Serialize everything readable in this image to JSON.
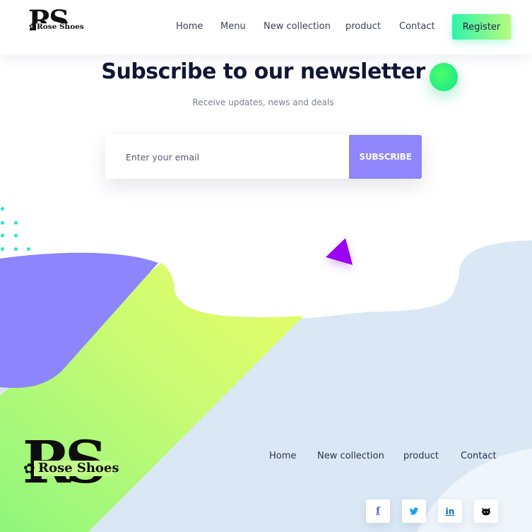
{
  "header": {
    "logo": {
      "monogram": "RS",
      "name": "Rose Shoes"
    },
    "nav": [
      "Home",
      "Menu",
      "New collection",
      "product",
      "Contact"
    ],
    "register_label": "Register"
  },
  "newsletter": {
    "title": "Subscribe to our newsletter",
    "subtitle": "Receive updates, news and deals",
    "email_placeholder": "Enter your email",
    "subscribe_label": "SUBSCRIBE"
  },
  "footer": {
    "logo": {
      "monogram": "RS",
      "name": "Rose Shoes"
    },
    "nav": [
      "Home",
      "New collection",
      "product",
      "Contact"
    ],
    "social": [
      {
        "icon": "facebook-icon",
        "glyph": "f",
        "color": "#3b5bdb"
      },
      {
        "icon": "twitter-icon",
        "glyph": "🐦",
        "color": "#1da1f2"
      },
      {
        "icon": "linkedin-icon",
        "glyph": "in",
        "color": "#0a66c2"
      },
      {
        "icon": "github-icon",
        "glyph": "🐱",
        "color": "#111111"
      }
    ]
  },
  "colors": {
    "accent_purple": "#8f86fb",
    "accent_green": "#2ef3a9",
    "lime": "#d4fc6a",
    "light_blue": "#d9e8f4",
    "triangle": "#9a00f2"
  }
}
